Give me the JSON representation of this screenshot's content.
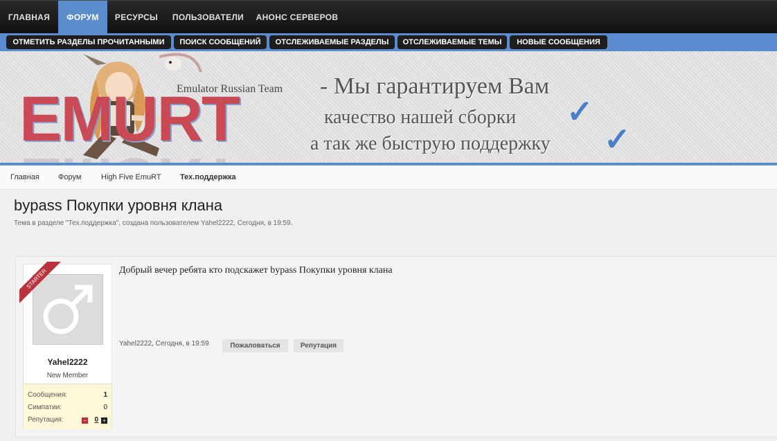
{
  "topnav": {
    "tabs": [
      {
        "label": "ГЛАВНАЯ"
      },
      {
        "label": "ФОРУМ",
        "active": true
      },
      {
        "label": "РЕСУРСЫ"
      },
      {
        "label": "ПОЛЬЗОВАТЕЛИ"
      },
      {
        "label": "АНОНС СЕРВЕРОВ"
      }
    ]
  },
  "subnav": {
    "items": [
      {
        "label": "ОТМЕТИТЬ РАЗДЕЛЫ ПРОЧИТАННЫМИ"
      },
      {
        "label": "ПОИСК СООБЩЕНИЙ"
      },
      {
        "label": "ОТСЛЕЖИВАЕМЫЕ РАЗДЕЛЫ"
      },
      {
        "label": "ОТСЛЕЖИВАЕМЫЕ ТЕМЫ"
      },
      {
        "label": "НОВЫЕ СООБЩЕНИЯ"
      }
    ]
  },
  "banner": {
    "logo": "EMURT",
    "logo_sub": "Emulator Russian Team",
    "slogan_1": "- Мы гарантируем Вам",
    "slogan_2": "качество нашей сборки",
    "slogan_3": "а так же быструю поддержку",
    "check_glyph": "✓"
  },
  "breadcrumb": {
    "items": [
      {
        "label": "Главная"
      },
      {
        "label": "Форум"
      },
      {
        "label": "High Five EmuRT"
      },
      {
        "label": "Тех.поддержка"
      }
    ]
  },
  "thread": {
    "title": "bypass Покупки уровня клана",
    "subtitle": "Тема в разделе \"Тех.поддержка\", создана пользователем Yahel2222, Сегодня, в 19:59."
  },
  "post": {
    "ribbon": "STARTER",
    "username": "Yahel2222",
    "role": "New Member",
    "stats": {
      "messages_label": "Сообщения:",
      "messages_value": "1",
      "likes_label": "Симпатии:",
      "likes_value": "0",
      "rep_label": "Репутация:",
      "rep_value": "0"
    },
    "message": "Добрый вечер ребята кто подскажет bypass Покупки уровня клана",
    "meta": "Yahel2222, Сегодня, в 19:59",
    "report_label": "Пожаловаться",
    "rep_label": "Репутация"
  }
}
